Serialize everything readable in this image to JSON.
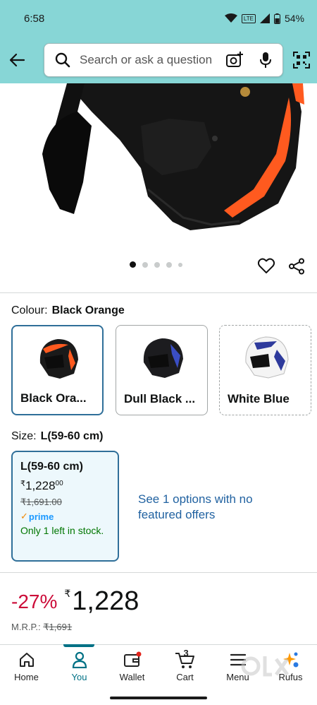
{
  "status_bar": {
    "time": "6:58",
    "battery": "54%",
    "network": "LTE"
  },
  "search": {
    "placeholder": "Search or ask a question",
    "icons": [
      "back-arrow-icon",
      "search-icon",
      "camera-icon",
      "microphone-icon",
      "qr-scan-icon"
    ]
  },
  "gallery": {
    "image_count": 5,
    "active_index": 0,
    "actions": [
      "heart-icon",
      "share-icon"
    ]
  },
  "colour": {
    "label": "Colour:",
    "selected": "Black Orange",
    "options": [
      {
        "label": "Black Ora...",
        "selected": true
      },
      {
        "label": "Dull Black ...",
        "selected": false
      },
      {
        "label": "White Blue",
        "selected": false
      }
    ]
  },
  "size": {
    "label": "Size:",
    "selected": "L(59-60 cm)",
    "card": {
      "size": "L(59-60 cm)",
      "currency": "₹",
      "price_whole": "1,228",
      "price_fraction": "00",
      "mrp": "₹1,691.00",
      "prime": "prime",
      "stock": "Only 1 left in stock."
    },
    "see_options": "See 1 options with no featured offers"
  },
  "price": {
    "discount": "-27%",
    "currency": "₹",
    "amount": "1,228",
    "mrp_label": "M.R.P.:",
    "mrp_value": "₹1,691"
  },
  "bottom_nav": {
    "items": [
      {
        "label": "Home",
        "icon": "home-icon"
      },
      {
        "label": "You",
        "icon": "profile-icon",
        "active": true
      },
      {
        "label": "Wallet",
        "icon": "wallet-icon"
      },
      {
        "label": "Cart",
        "icon": "cart-icon",
        "badge": "3"
      },
      {
        "label": "Menu",
        "icon": "menu-icon"
      },
      {
        "label": "Rufus",
        "icon": "rufus-icon"
      }
    ]
  },
  "watermark": {
    "text": "OLX INDIA"
  },
  "colors": {
    "header": "#87d6d6",
    "accent": "#007185",
    "link": "#2162a1",
    "deal": "#cc0c39",
    "stock": "#007600"
  }
}
